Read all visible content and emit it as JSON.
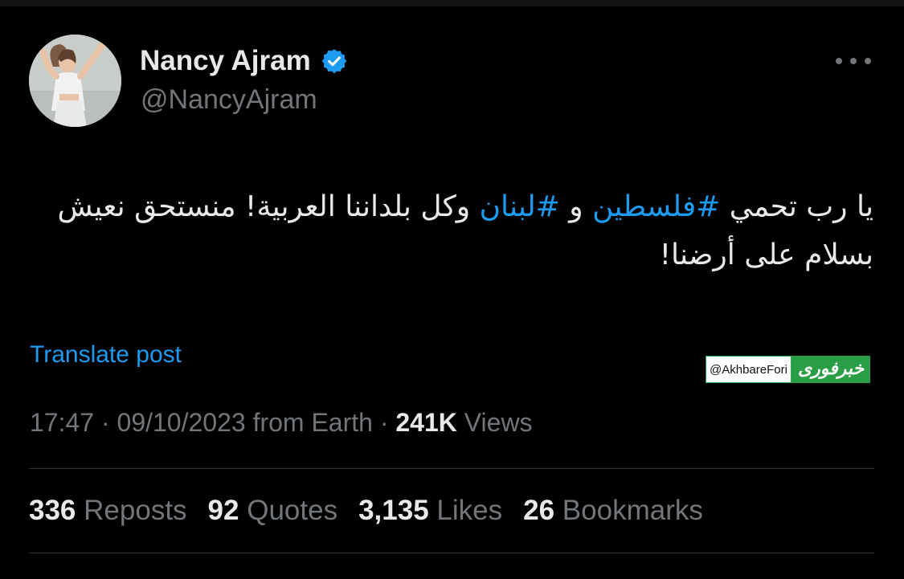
{
  "author": {
    "display_name": "Nancy Ajram",
    "handle": "@NancyAjram",
    "verified": true
  },
  "tweet": {
    "segments": [
      {
        "text": "يا رب تحمي ",
        "hashtag": false
      },
      {
        "text": "#فلسطين",
        "hashtag": true
      },
      {
        "text": " و ",
        "hashtag": false
      },
      {
        "text": "#لبنان",
        "hashtag": true
      },
      {
        "text": " وكل بلداننا العربية! منستحق نعيش بسلام على أرضنا!",
        "hashtag": false
      }
    ]
  },
  "translate_label": "Translate post",
  "watermark": {
    "handle": "@AkhbareFori",
    "logo_text": "خبرفوری"
  },
  "meta": {
    "time": "17:47",
    "separator": "·",
    "date": "09/10/2023",
    "source": "from Earth",
    "views_count": "241K",
    "views_label": "Views"
  },
  "stats": {
    "reposts": {
      "count": "336",
      "label": "Reposts"
    },
    "quotes": {
      "count": "92",
      "label": "Quotes"
    },
    "likes": {
      "count": "3,135",
      "label": "Likes"
    },
    "bookmarks": {
      "count": "26",
      "label": "Bookmarks"
    }
  },
  "colors": {
    "background": "#000000",
    "text": "#e7e9ea",
    "secondary": "#71767b",
    "accent": "#1d9bf0",
    "divider": "#2f3336"
  },
  "icons": {
    "verified": "verified-badge-icon",
    "more": "more-options-icon"
  }
}
